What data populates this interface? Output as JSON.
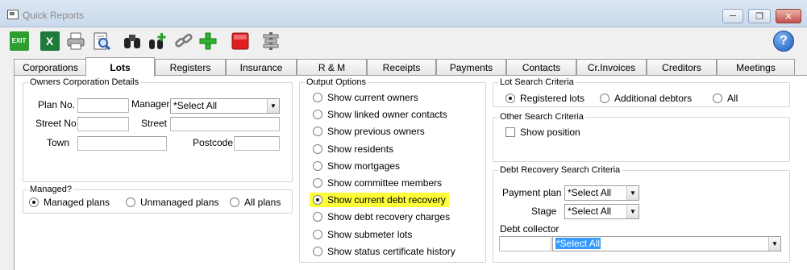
{
  "window": {
    "title": "Quick Reports"
  },
  "toolbar": {
    "exit_label": "EXIT",
    "excel_label": "X",
    "buttons": [
      "exit-icon",
      "excel-icon",
      "print-icon",
      "preview-icon",
      "binoculars-icon",
      "binoculars-add-icon",
      "link-icon",
      "add-icon",
      "stop-icon",
      "align-icon"
    ],
    "help_label": "?"
  },
  "tabs": [
    "Corporations",
    "Lots",
    "Registers",
    "Insurance",
    "R & M",
    "Receipts",
    "Payments",
    "Contacts",
    "Cr.Invoices",
    "Creditors",
    "Meetings"
  ],
  "owners": {
    "legend": "Owners Corporation Details",
    "plan_no_label": "Plan No.",
    "plan_no_value": "",
    "manager_label": "Manager",
    "manager_value": "*Select All",
    "street_no_label": "Street No",
    "street_label": "Street",
    "town_label": "Town",
    "postcode_label": "Postcode"
  },
  "managed": {
    "legend": "Managed?",
    "options": [
      "Managed plans",
      "Unmanaged plans",
      "All plans"
    ],
    "selected": 0
  },
  "output": {
    "legend": "Output Options",
    "options": [
      "Show current owners",
      "Show linked owner contacts",
      "Show previous owners",
      "Show residents",
      "Show mortgages",
      "Show committee members",
      "Show current debt recovery",
      "Show debt recovery charges",
      "Show submeter lots",
      "Show status certificate history"
    ],
    "selected": 6,
    "highlight_color": "#fdfd3a"
  },
  "lot_search": {
    "legend": "Lot Search Criteria",
    "options": [
      "Registered lots",
      "Additional debtors",
      "All"
    ],
    "selected": 0
  },
  "other_search": {
    "legend": "Other Search Criteria",
    "show_position_label": "Show position",
    "show_position_checked": false
  },
  "debt": {
    "legend": "Debt Recovery Search Criteria",
    "payment_plan_label": "Payment plan",
    "payment_plan_value": "*Select All",
    "stage_label": "Stage",
    "stage_value": "*Select All",
    "collector_label": "Debt collector",
    "collector_code": "",
    "collector_value": "*Select All"
  },
  "colors": {
    "selection": "#3399ff",
    "close_button": "#c75050"
  }
}
